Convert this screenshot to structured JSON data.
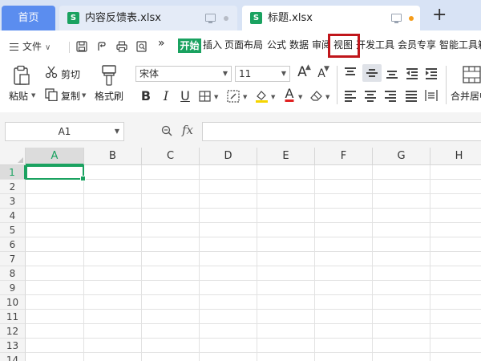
{
  "tabs": {
    "home": "首页",
    "documents": [
      {
        "icon": "S",
        "title": "内容反馈表.xlsx",
        "active": false
      },
      {
        "icon": "S",
        "title": "标题.xlsx",
        "active": true
      }
    ],
    "new_tab": "+"
  },
  "menubar": {
    "file": "文件",
    "more": "»",
    "items": [
      "开始",
      "插入",
      "页面布局",
      "公式",
      "数据",
      "审阅",
      "视图",
      "开发工具",
      "会员专享",
      "智能工具箱"
    ],
    "active_item": "开始",
    "highlighted_item": "视图"
  },
  "ribbon": {
    "paste": "粘贴",
    "cut": "剪切",
    "copy": "复制",
    "format_painter": "格式刷",
    "font_name": "宋体",
    "font_size": "11",
    "bold": "B",
    "italic": "I",
    "underline": "U",
    "font_color_letter": "A",
    "increase_font": "A",
    "decrease_font": "A",
    "merge_center": "合并居中"
  },
  "formula_bar": {
    "cell_ref": "A1",
    "fx": "fx",
    "value": ""
  },
  "sheet": {
    "columns": [
      "A",
      "B",
      "C",
      "D",
      "E",
      "F",
      "G",
      "H"
    ],
    "rows": [
      "1",
      "2",
      "3",
      "4",
      "5",
      "6",
      "7",
      "8",
      "9",
      "10",
      "11",
      "12",
      "13",
      "14"
    ],
    "selected_cell": "A1"
  },
  "colors": {
    "accent": "#1aa260",
    "tabbar": "#d8e3f5",
    "home_tab": "#5b8def",
    "highlight_box": "#c0161b"
  }
}
